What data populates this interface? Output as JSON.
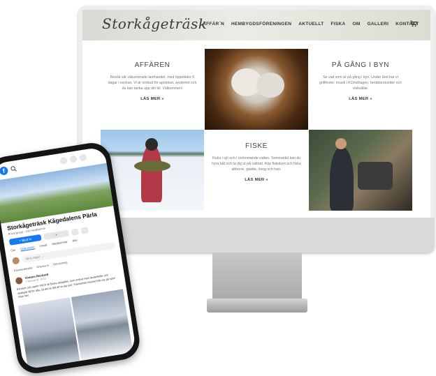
{
  "website": {
    "logo": "Storkågeträsk",
    "nav": [
      "AFFÄR´N",
      "HEMBYGDSFÖRENINGEN",
      "AKTUELLT",
      "FISKA",
      "OM",
      "GALLERI",
      "KONTAKT"
    ],
    "cards": [
      {
        "title": "AFFÄREN",
        "text": "Besök vår välsorterade lanthandel, med öppettider 6 dagar i veckan. Vi är ombud för apoteket, systemet och du kan tanka upp din bil. Välkommen!",
        "link": "LÄS MER »"
      },
      {
        "title": "PÅ GÅNG I BYN",
        "text": "Se vad som är på gång i byn. Under året har vi grillfester, musik i KOnsthagen, berättarstunder och viskvällar.",
        "link": "LÄS MER »"
      },
      {
        "title": "FISKE",
        "text": "Fiska i sjö och i strömmande vatten. Sommartid kan du hyra båt och ta dig ut på vattnet. Köp fiskekort och fiska abborre, gädda, öring och harr.",
        "link": "LÄS MER »"
      }
    ]
  },
  "phone": {
    "group_title": "Storkågeträsk Kågedalens Pärla",
    "group_meta": "Privat grupp · 192 medlemmar",
    "buttons": {
      "joined": "+ Bjud in",
      "member": "+",
      "more": "..."
    },
    "tabs": [
      "Om",
      "Diskussion",
      "Utvalt",
      "Medlemmar",
      "Mer"
    ],
    "compose_placeholder": "Skriv något ...",
    "actions": [
      "Känsla/aktivitet",
      "Checka in",
      "Omröstning"
    ],
    "post": {
      "author": "Viviann Reckzell",
      "time": "7 februari kl. 16:02",
      "text": "Ett stort och varmt TACK till Berra afsbjälke, som ordnat med skoterleder och skidspår till för alla, så det är lätt att ta sig runt. Fantastiskt mycket folk ute på sjön! Visa mer"
    }
  }
}
